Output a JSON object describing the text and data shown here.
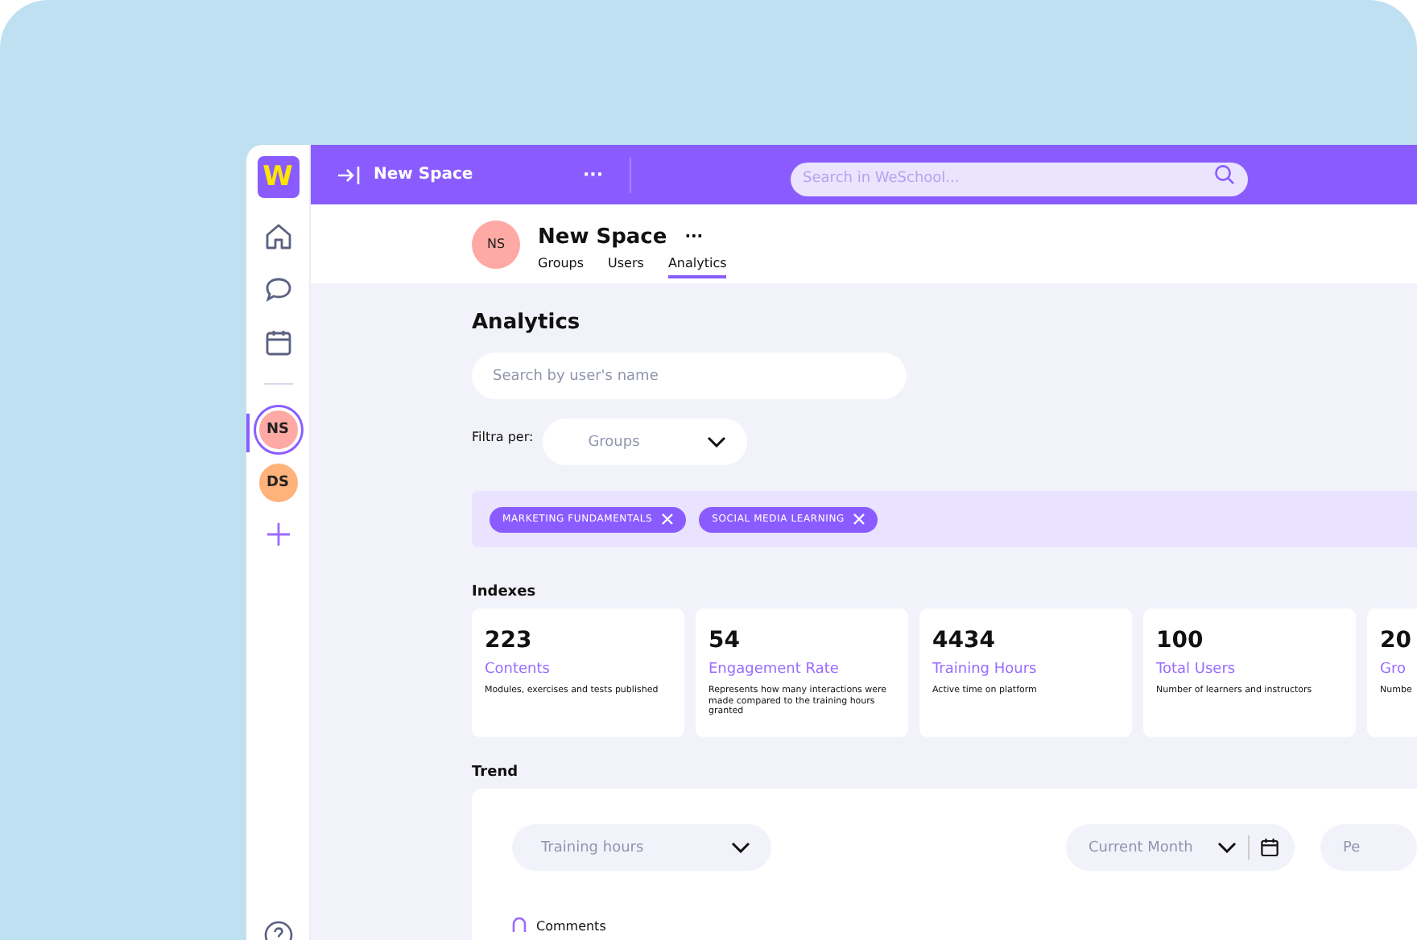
{
  "topbar": {
    "space_name": "New Space",
    "more": "···",
    "search": {
      "placeholder": "Search in WeSchool..."
    }
  },
  "sidebar": {
    "logo": "W",
    "spaces": [
      {
        "initials": "NS",
        "color": "#ffa9a4",
        "selected": true
      },
      {
        "initials": "DS",
        "color": "#ffb27a",
        "selected": false
      }
    ]
  },
  "header": {
    "initials": "NS",
    "title": "New Space",
    "more": "···",
    "tabs": [
      {
        "label": "Groups",
        "selected": false
      },
      {
        "label": "Users",
        "selected": false
      },
      {
        "label": "Analytics",
        "selected": true
      }
    ]
  },
  "page": {
    "title": "Analytics",
    "search": {
      "placeholder": "Search by user's name"
    },
    "filter": {
      "label": "Filtra per:",
      "dropdown": "Groups"
    },
    "tags": [
      {
        "label": "MARKETING FUNDAMENTALS"
      },
      {
        "label": "SOCIAL MEDIA LEARNING"
      }
    ]
  },
  "indexes": {
    "title": "Indexes",
    "cards": [
      {
        "value": "223",
        "label": "Contents",
        "description": "Modules, exercises and tests published"
      },
      {
        "value": "54",
        "label": "Engagement Rate",
        "description": "Represents how many interactions were made compared to the training hours granted"
      },
      {
        "value": "4434",
        "label": "Training Hours",
        "description": "Active time on platform"
      },
      {
        "value": "100",
        "label": "Total Users",
        "description": "Number of learners and instructors"
      },
      {
        "value": "20",
        "label": "Gro",
        "description": "Numbe"
      }
    ]
  },
  "trend": {
    "title": "Trend",
    "metric_dropdown": "Training hours",
    "period_dropdown": "Current Month",
    "dropdown_3": "Pe",
    "legend": [
      {
        "label": "Comments"
      }
    ]
  }
}
